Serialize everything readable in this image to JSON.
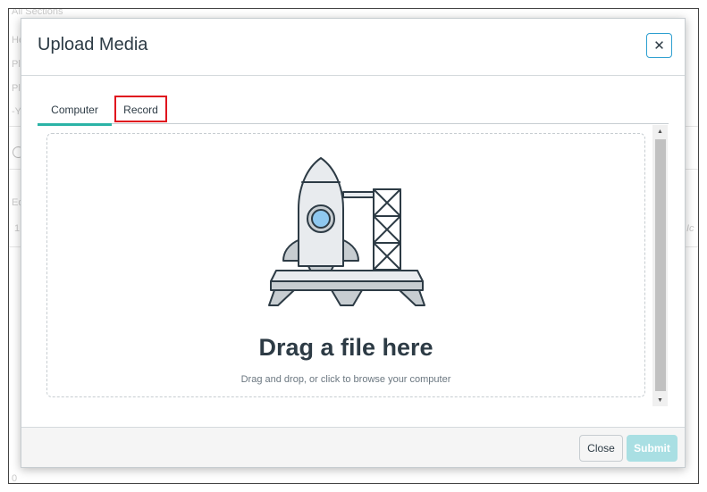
{
  "background": {
    "section_label": "All Sections",
    "row_letters": [
      "He",
      "Pl",
      "Pl",
      "-Y"
    ],
    "misc_left": [
      "Ed",
      "1"
    ],
    "misc_right": "Ic",
    "footer_fragment": "0"
  },
  "dialog": {
    "title": "Upload Media",
    "close_icon_glyph": "✕",
    "tabs": [
      {
        "label": "Computer",
        "active": true
      },
      {
        "label": "Record",
        "active": false,
        "highlighted": true
      }
    ],
    "dropzone": {
      "title": "Drag a file here",
      "subtitle": "Drag and drop, or click to browse your computer",
      "illustration": "rocket-launch-pad"
    },
    "scrollbar": {
      "up_glyph": "▲",
      "down_glyph": "▼"
    },
    "footer": {
      "close_label": "Close",
      "submit_label": "Submit"
    }
  },
  "colors": {
    "accent": "#2bb3a6",
    "highlight_box": "#e0141e",
    "submit_disabled": "#a9dfe3",
    "text_primary": "#2d3b45"
  }
}
